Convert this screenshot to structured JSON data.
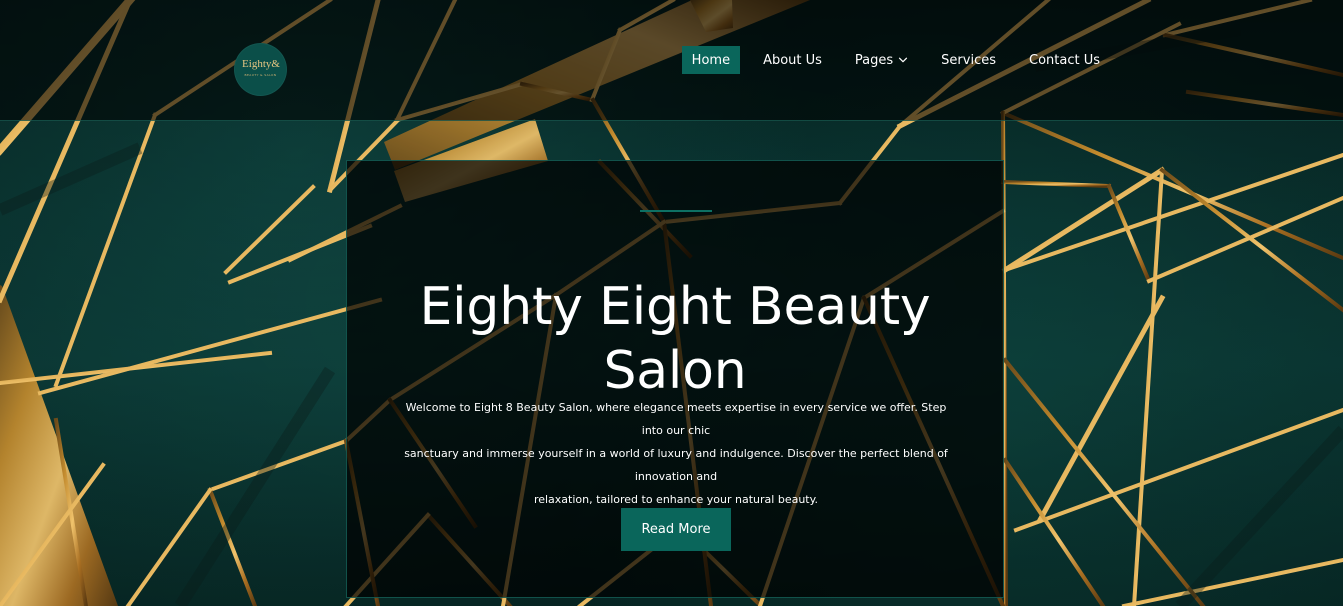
{
  "header": {
    "logo": {
      "main": "Eighty&",
      "sub": "beauty & salon"
    },
    "nav": [
      {
        "label": "Home"
      },
      {
        "label": "About Us"
      },
      {
        "label": "Pages"
      },
      {
        "label": "Services"
      },
      {
        "label": "Contact Us"
      }
    ]
  },
  "hero": {
    "title_line_1": "Eighty Eight Beauty",
    "title_line_2": "Salon",
    "description_line_1": "Welcome to Eight 8 Beauty Salon, where elegance meets expertise in every service we offer. Step into our chic",
    "description_line_2": "sanctuary and immerse yourself in a world of luxury and indulgence. Discover the perfect blend of innovation and",
    "description_line_3": "relaxation, tailored to enhance your natural beauty.",
    "button_label": "Read More"
  },
  "colors": {
    "accent": "#0a665b",
    "background": "#0b3a36",
    "gold": "#c9922e"
  },
  "icons": {
    "dropdown": "chevron-down-icon"
  }
}
